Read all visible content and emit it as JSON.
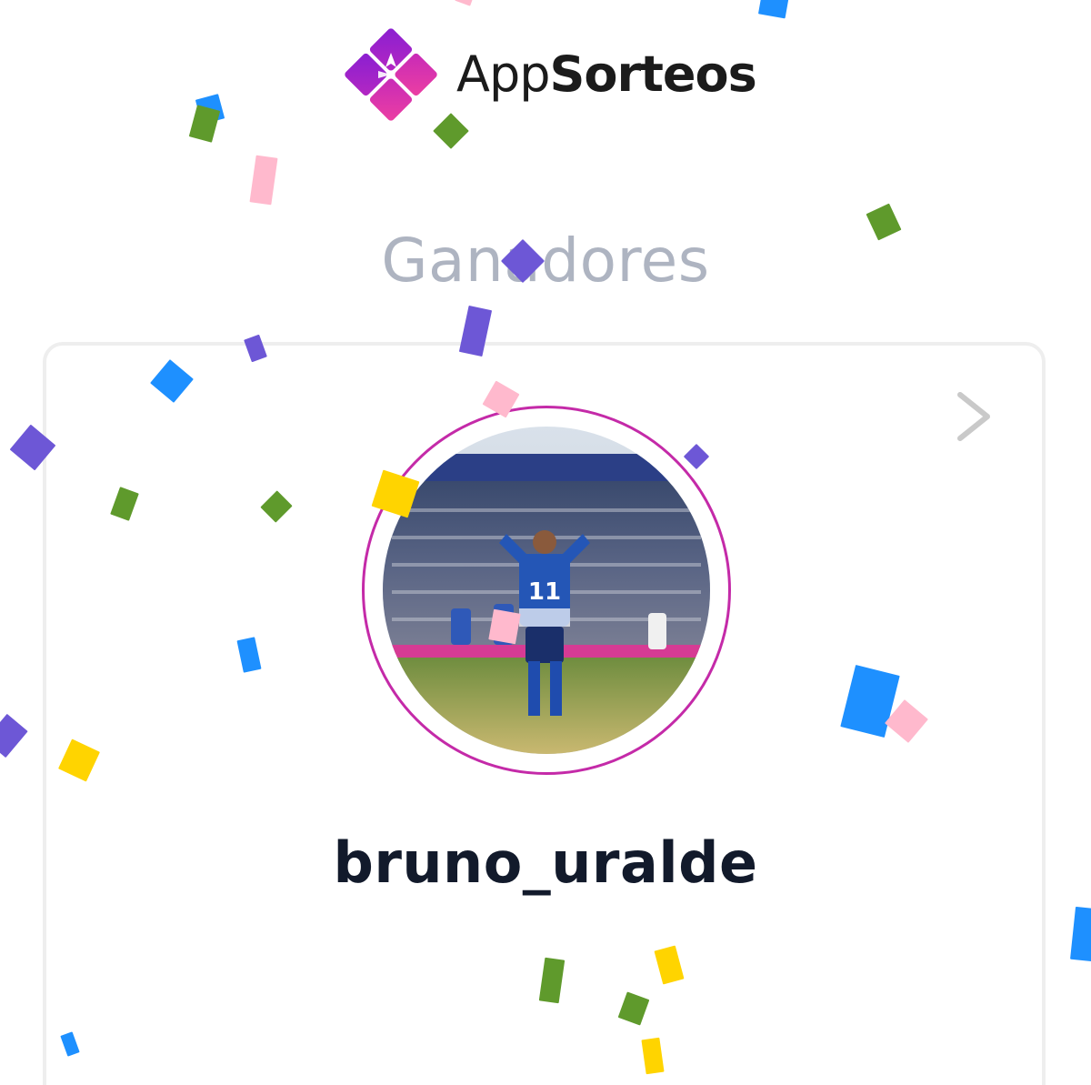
{
  "header": {
    "brand_light": "App",
    "brand_bold": "Sorteos",
    "logo_icon": "gift-box-icon",
    "brand_colors": [
      "#8a1fd1",
      "#c72ab8",
      "#ec3fa2"
    ]
  },
  "results": {
    "title": "Ganadores",
    "winners": [
      {
        "username": "bruno_uralde",
        "avatar_icon": "profile-photo",
        "avatar_ring_color": "#c42aa8"
      }
    ],
    "detail_icon": "chevron-right-icon"
  },
  "decor": {
    "confetti_colors": [
      "#1e90ff",
      "#5f9a2c",
      "#ffb9cd",
      "#6d57d6",
      "#ffd400"
    ]
  }
}
